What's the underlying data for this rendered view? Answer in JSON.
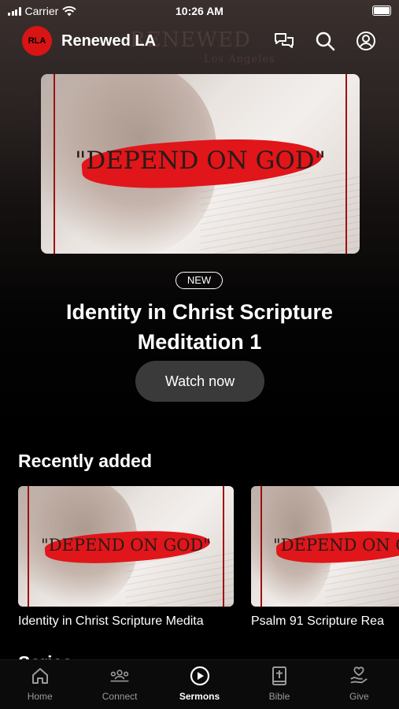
{
  "status_bar": {
    "carrier": "Carrier",
    "time": "10:26 AM"
  },
  "header": {
    "title": "Renewed LA",
    "logo_text": "RLA",
    "background_wordmark": "RENEWED",
    "background_wordmark_sub": "Los Angeles"
  },
  "hero": {
    "thumbnail_text": "\"DEPEND ON GOD\"",
    "badge": "NEW",
    "title": "Identity in Christ Scripture Meditation 1",
    "watch_label": "Watch now"
  },
  "recently_added": {
    "heading": "Recently added",
    "items": [
      {
        "title": "Identity in Christ Scripture Medita",
        "thumbnail_text": "\"DEPEND ON GOD\""
      },
      {
        "title": "Psalm 91 Scripture Rea",
        "thumbnail_text": "\"DEPEND ON G"
      }
    ]
  },
  "series": {
    "heading": "Series",
    "chevron": "›"
  },
  "tabs": [
    {
      "label": "Home",
      "icon": "home-icon",
      "active": false
    },
    {
      "label": "Connect",
      "icon": "people-icon",
      "active": false
    },
    {
      "label": "Sermons",
      "icon": "play-circle-icon",
      "active": true
    },
    {
      "label": "Bible",
      "icon": "bible-icon",
      "active": false
    },
    {
      "label": "Give",
      "icon": "give-icon",
      "active": false
    }
  ],
  "colors": {
    "accent_red": "#e0161a",
    "button_bg": "#3a3a3a",
    "tab_active": "#ffffff",
    "tab_inactive": "#9a9a9a"
  }
}
